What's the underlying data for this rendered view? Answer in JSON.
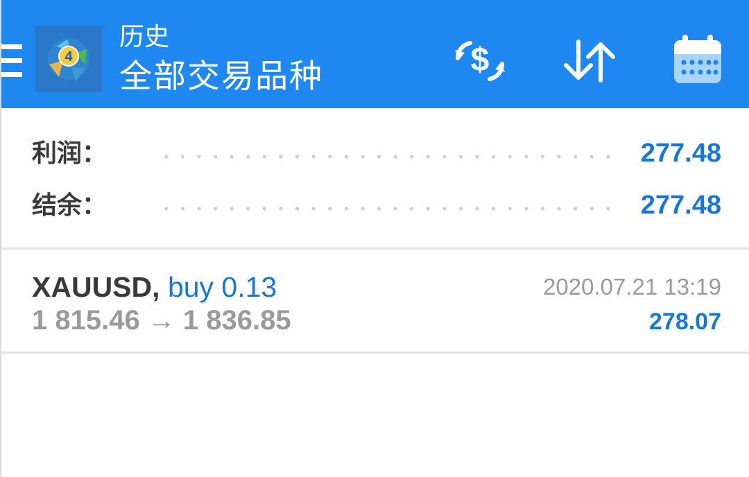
{
  "header": {
    "title": "历史",
    "subtitle": "全部交易品种",
    "icons": {
      "menu": "hamburger-icon",
      "logo": "metatrader4-logo",
      "deposit": "dollar-exchange-icon",
      "sort": "sort-arrows-icon",
      "period": "calendar-icon"
    }
  },
  "summary": {
    "profit_label": "利润：",
    "profit_value": "277.48",
    "balance_label": "结余：",
    "balance_value": "277.48"
  },
  "deals": [
    {
      "symbol": "XAUUSD,",
      "type": "buy 0.13",
      "prices": "1 815.46 → 1 836.85",
      "time": "2020.07.21 13:19",
      "profit": "278.07"
    }
  ],
  "colors": {
    "header_bg": "#1e88f0",
    "accent_blue": "#1877d4",
    "label_dark": "#3a3a3a",
    "muted_gray": "#9a9a9a",
    "divider": "#e3e3e3"
  }
}
